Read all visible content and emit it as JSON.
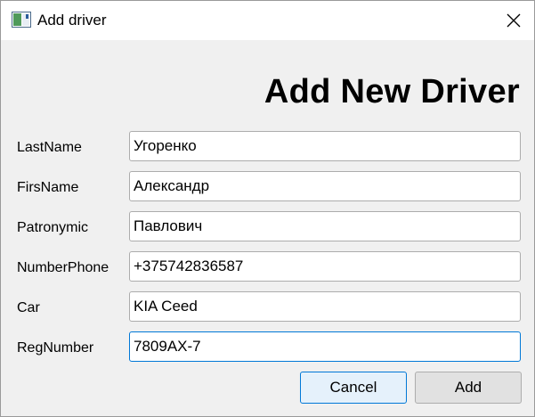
{
  "window": {
    "title": "Add driver"
  },
  "form": {
    "heading": "Add New Driver",
    "fields": [
      {
        "label": "LastName",
        "value": "Угоренко"
      },
      {
        "label": "FirsName",
        "value": "Александр"
      },
      {
        "label": "Patronymic",
        "value": "Павлович"
      },
      {
        "label": "NumberPhone",
        "value": "+375742836587"
      },
      {
        "label": "Car",
        "value": "KIA Ceed"
      },
      {
        "label": "RegNumber",
        "value": "7809AX-7"
      }
    ]
  },
  "buttons": {
    "cancel_label": "Cancel",
    "add_label": "Add"
  },
  "colors": {
    "focus_accent": "#0078d7",
    "background": "#f0f0f0"
  }
}
